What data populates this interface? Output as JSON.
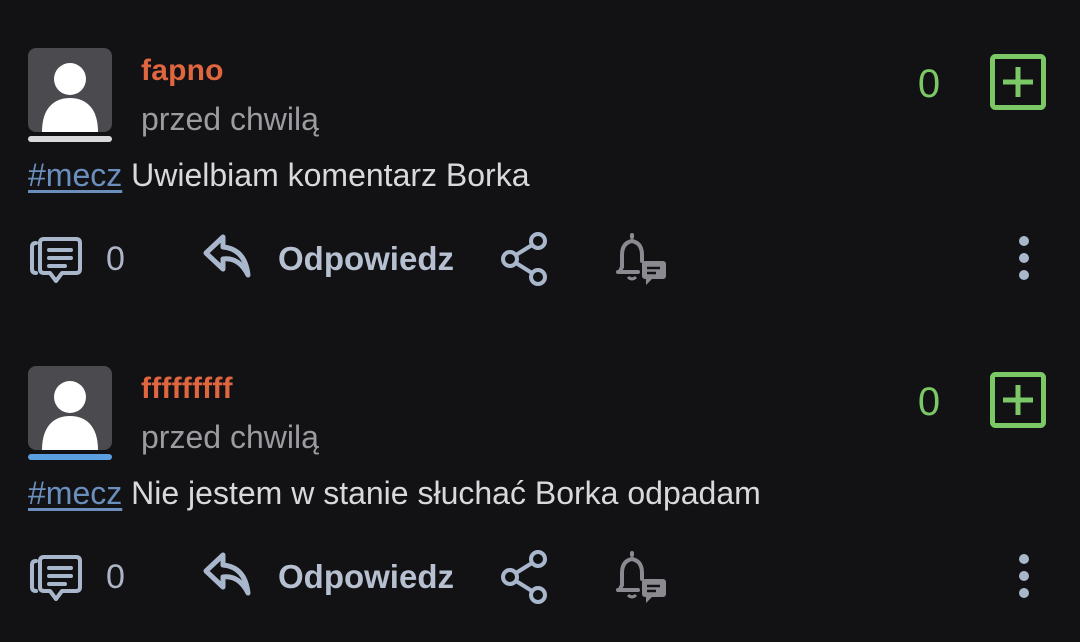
{
  "colors": {
    "background": "#121114",
    "username": "#e0663f",
    "score": "#7cc866",
    "hashtag": "#6b8fbd",
    "action_icon": "#a9b7cc",
    "muted": "#9b9ba0"
  },
  "posts": [
    {
      "username": "fapno",
      "timestamp": "przed chwilą",
      "score": "0",
      "hashtag": "#mecz",
      "text": " Uwielbiam komentarz Borka",
      "comment_count": "0",
      "reply_label": "Odpowiedz",
      "avatar_underline_color": "#d9d9dc"
    },
    {
      "username": "fffffffff",
      "timestamp": "przed chwilą",
      "score": "0",
      "hashtag": "#mecz",
      "text": " Nie jestem w stanie słuchać Borka odpadam",
      "comment_count": "0",
      "reply_label": "Odpowiedz",
      "avatar_underline_color": "#5b9fe0"
    }
  ],
  "icons": {
    "avatar": "user-avatar-icon",
    "plus": "plus-vote-icon",
    "comments": "comments-icon",
    "reply": "reply-icon",
    "share": "share-icon",
    "notify": "bell-message-icon",
    "more": "more-vertical-icon"
  }
}
